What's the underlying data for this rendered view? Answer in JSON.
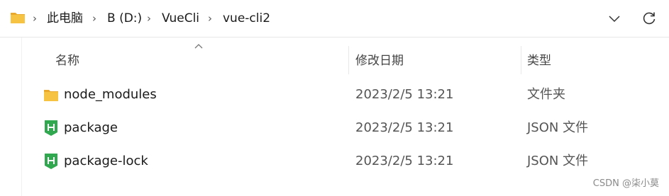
{
  "breadcrumb": {
    "items": [
      {
        "label": "此电脑"
      },
      {
        "label": "B (D:)"
      },
      {
        "label": "VueCli"
      },
      {
        "label": "vue-cli2"
      }
    ],
    "separator": "›",
    "folder_icon": "folder-icon",
    "dropdown_icon": "chevron-down-icon",
    "refresh_icon": "refresh-icon"
  },
  "columns": {
    "name": "名称",
    "date": "修改日期",
    "type": "类型",
    "sort": "ascending-by-name"
  },
  "files": [
    {
      "name": "node_modules",
      "date": "2023/2/5 13:21",
      "type": "文件夹",
      "icon": "folder-icon"
    },
    {
      "name": "package",
      "date": "2023/2/5 13:21",
      "type": "JSON 文件",
      "icon": "json-file-icon"
    },
    {
      "name": "package-lock",
      "date": "2023/2/5 13:21",
      "type": "JSON 文件",
      "icon": "json-file-icon"
    }
  ],
  "watermark": "CSDN @柒小莫",
  "colors": {
    "folder": "#f6c343",
    "json_icon": "#2fa84f",
    "text_secondary": "#555555"
  }
}
